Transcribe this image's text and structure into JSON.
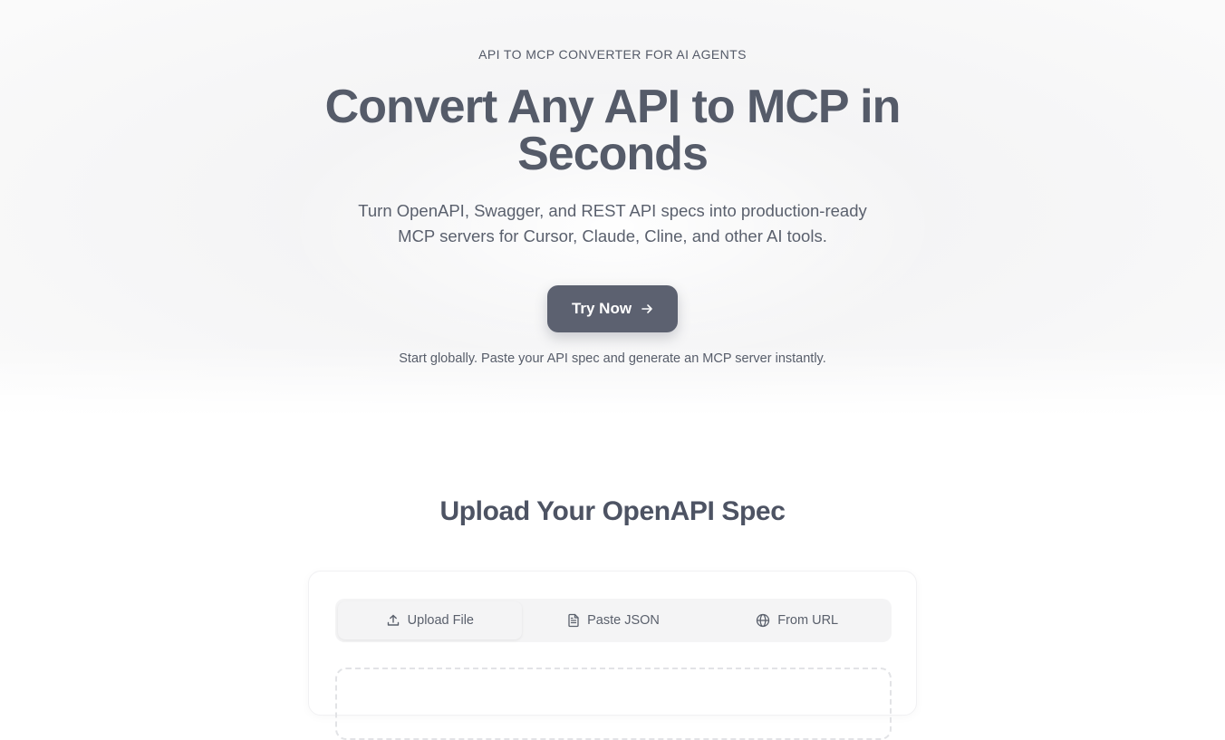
{
  "hero": {
    "eyebrow": "API TO MCP CONVERTER FOR AI AGENTS",
    "headline": "Convert Any API to MCP in Seconds",
    "subtitle": "Turn OpenAPI, Swagger, and REST API specs into production-ready MCP servers for Cursor, Claude, Cline, and other AI tools.",
    "cta_label": "Try Now",
    "cta_icon": "arrow-right-icon",
    "note": "Start globally. Paste your API spec and generate an MCP server instantly."
  },
  "upload": {
    "title": "Upload Your OpenAPI Spec",
    "tabs": [
      {
        "label": "Upload File",
        "icon": "upload-icon",
        "active": true
      },
      {
        "label": "Paste JSON",
        "icon": "file-text-icon",
        "active": false
      },
      {
        "label": "From URL",
        "icon": "globe-icon",
        "active": false
      }
    ]
  },
  "colors": {
    "primary_button": "#5c6170",
    "heading_text": "#555b69",
    "body_text": "#5a606d",
    "tabs_background": "#f4f4f5"
  }
}
